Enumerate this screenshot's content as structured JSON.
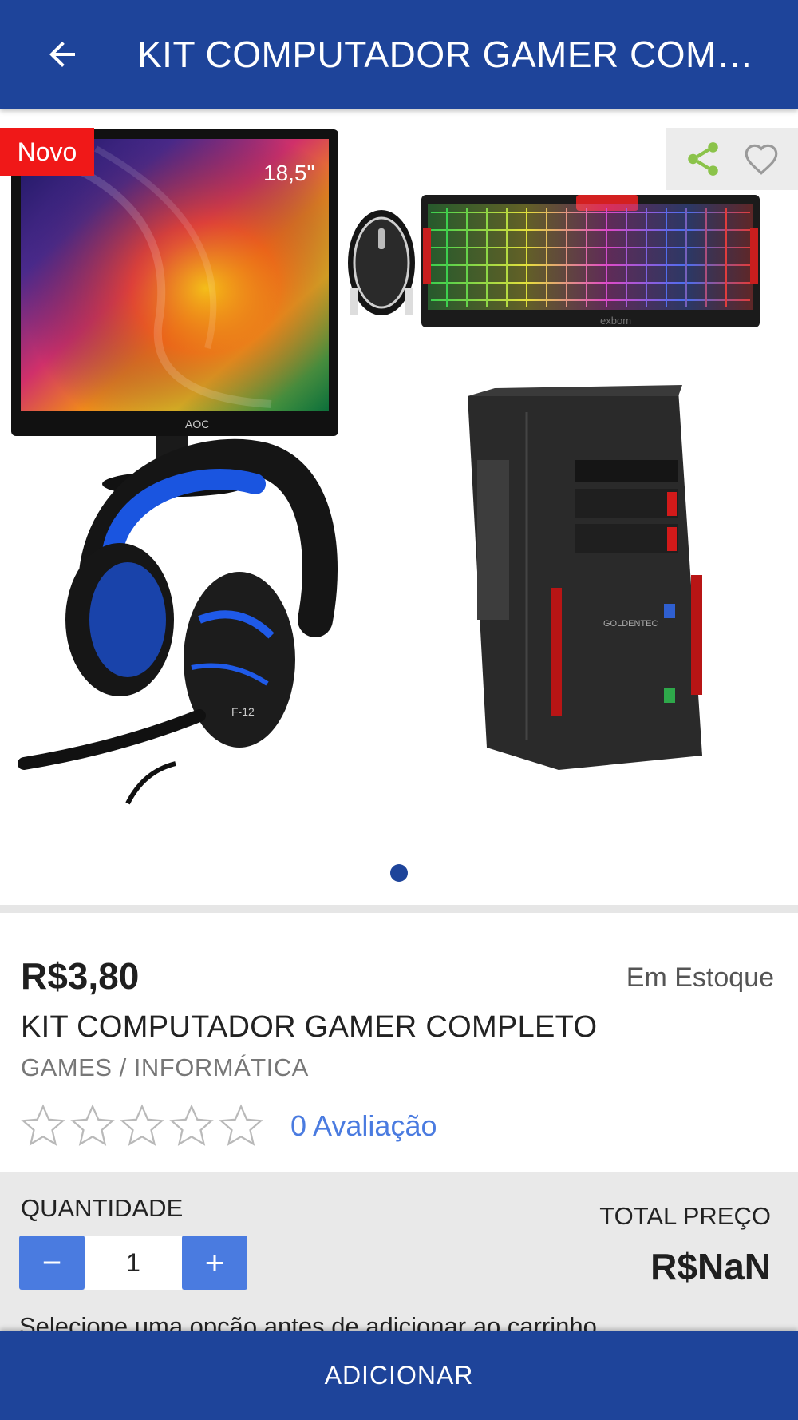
{
  "header": {
    "title": "KIT COMPUTADOR GAMER COMP...",
    "back_icon": "arrow-left-icon"
  },
  "gallery": {
    "badge": "Novo",
    "monitor_size_label": "18,5\"",
    "monitor_brand": "AOC",
    "keyboard_brand": "exbom",
    "headset_model": "F-12",
    "case_brand": "GOLDENTEC",
    "share_icon": "share-icon",
    "favorite_icon": "heart-outline-icon",
    "pages": 1,
    "active_page": 1
  },
  "product": {
    "price": "R$3,80",
    "stock": "Em Estoque",
    "name": "KIT COMPUTADOR GAMER COMPLETO",
    "category": "GAMES / INFORMÁTICA",
    "rating": 0,
    "rating_max": 5,
    "reviews": "0 Avaliação"
  },
  "quantity": {
    "label": "QUANTIDADE",
    "value": "1",
    "decrement": "−",
    "increment": "+",
    "total_label": "TOTAL PREÇO",
    "total_value": "R$NaN",
    "notice": "Selecione uma opção antes de adicionar ao carrinho"
  },
  "footer": {
    "add_label": "ADICIONAR"
  },
  "colors": {
    "primary": "#1e449a",
    "accent": "#4a7be0",
    "badge": "#f01818",
    "share": "#8bc34a"
  }
}
